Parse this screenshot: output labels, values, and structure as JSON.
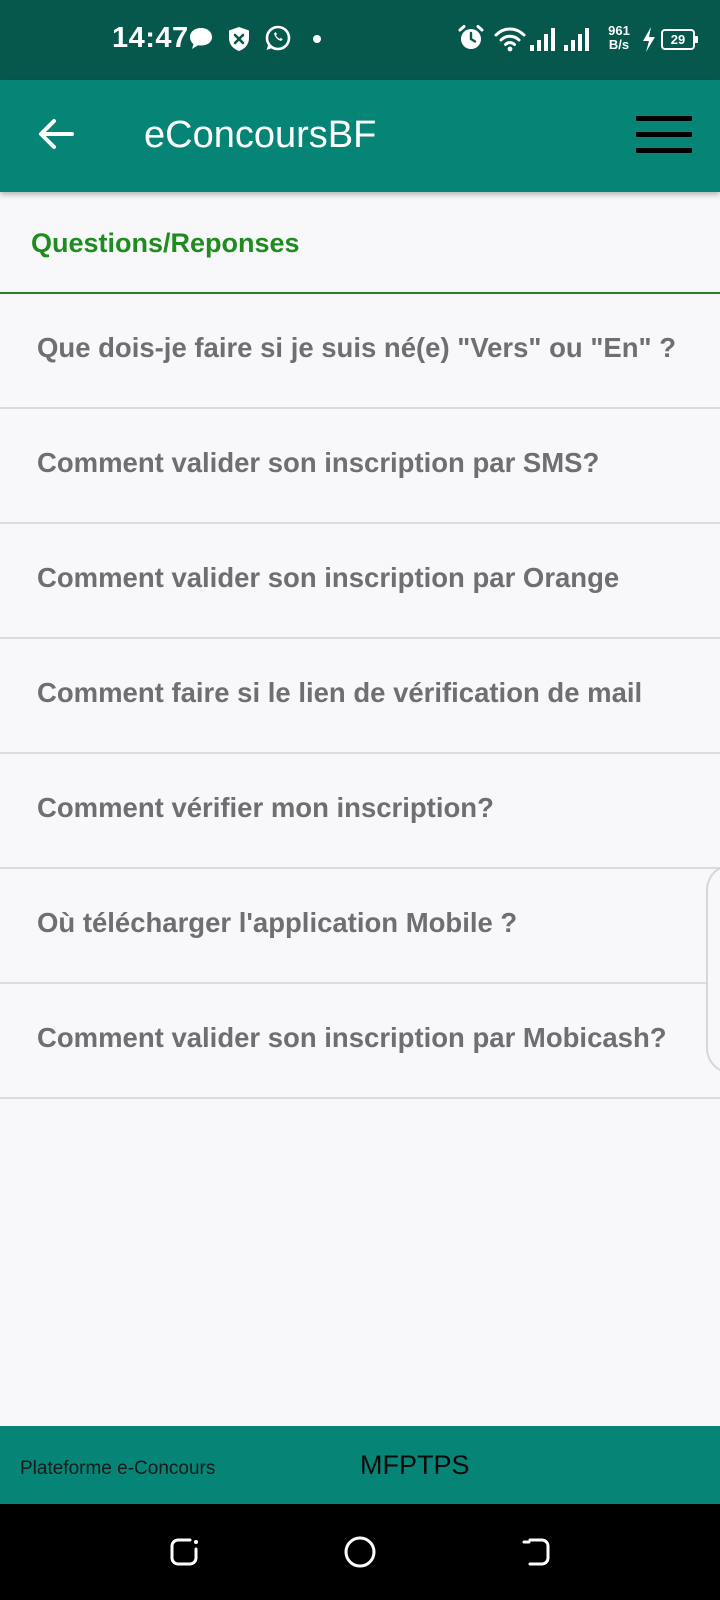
{
  "status_bar": {
    "time": "14:47",
    "net_speed_value": "961",
    "net_speed_unit": "B/s",
    "battery_level": "29",
    "icons": [
      "chat-bubble-icon",
      "shield-icon",
      "whatsapp-icon",
      "dot-icon",
      "alarm-icon",
      "wifi-icon",
      "signal-icon",
      "signal-icon",
      "charging-icon",
      "battery-icon"
    ]
  },
  "app_bar": {
    "title": "eConcoursBF",
    "back_icon": "arrow-left-icon",
    "menu_icon": "hamburger-menu-icon"
  },
  "section": {
    "title": "Questions/Reponses"
  },
  "faq": [
    "Que dois-je faire si je suis né(e) \"Vers\" ou \"En\" ?",
    "Comment valider son inscription par SMS?",
    "Comment valider son inscription par Orange",
    "Comment faire si le lien de vérification de mail",
    "Comment vérifier mon inscription?",
    "Où télécharger l'application Mobile ?",
    "Comment valider son inscription par Mobicash?"
  ],
  "footer": {
    "left": "Plateforme e-Concours",
    "center": "MFPTPS"
  },
  "colors": {
    "status_bar": "#06584d",
    "app_bar": "#068577",
    "section_title": "#1f8c1f",
    "question_text": "#6f6f71"
  }
}
